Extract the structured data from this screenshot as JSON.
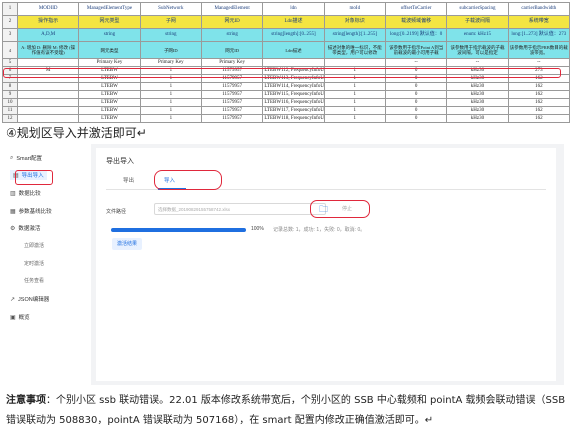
{
  "sheet": {
    "row_numbers": [
      "1",
      "2",
      "3",
      "4",
      "5",
      "6",
      "7",
      "8",
      "9",
      "10",
      "11",
      "12"
    ],
    "row1": [
      "MODIID",
      "ManagedElementType",
      "SubNetwork",
      "ManagedElement",
      "ldn",
      "moId",
      "offsetToCarrier",
      "subcarrierSpacing",
      "carrierBandwidth"
    ],
    "row2": [
      "操作指示",
      "网元类型",
      "子网",
      "网元ID",
      "Ldn描述",
      "对象标识",
      "载波频域偏移",
      "子载波间隔",
      "系统带宽"
    ],
    "row3": [
      "A,D,M",
      "string",
      "string",
      "string",
      "string[length]:[0..255]",
      "string[length]:[1..255]",
      "long:[0..2199]\n默认值：0",
      "enum:\nkHz15",
      "long:[1..273]\n默认值：273"
    ],
    "row4": [
      "A: 增加 D: 删除 M: 修改\n(操作值有误不受理)",
      "网元类型",
      "子网ID",
      "网元ID",
      "Ldn描述",
      "描述对象的唯一标识，不能带类型，用户可以修改",
      "该参数用于指示Point A到当前载波的最小可用子载",
      "该参数用于指示载波的子载波间隔，可以是指定",
      "该参数用于指示PRB数目的载波带宽。"
    ],
    "row5": [
      "",
      "",
      "",
      "",
      "",
      "Primary Key",
      "",
      "",
      "Primary Key",
      "Primary Key",
      "",
      "",
      "",
      ""
    ],
    "row5_cells": [
      "",
      "",
      "Primary Key",
      "Primary Key",
      "Primary Key",
      "",
      "Primary Key",
      "--",
      "--",
      "--"
    ],
    "data_rows": [
      {
        "rn": "6",
        "cells": [
          "M",
          "LTEBW",
          "1",
          "11579957",
          "LTEBW112, FrequencyInfoUL=1,",
          "1",
          "0",
          "kHz30",
          "273"
        ]
      },
      {
        "rn": "7",
        "cells": [
          "",
          "LTEBW",
          "1",
          "11579957",
          "LTEBW113, FrequencyInfoUL=1,",
          "1",
          "0",
          "kHz30",
          "162"
        ]
      },
      {
        "rn": "8",
        "cells": [
          "",
          "LTEBW",
          "1",
          "11579957",
          "LTEBW114, FrequencyInfoUL=1,",
          "1",
          "0",
          "kHz30",
          "162"
        ]
      },
      {
        "rn": "9",
        "cells": [
          "",
          "LTEBW",
          "1",
          "11579957",
          "LTEBW115, FrequencyInfoUL=1,",
          "1",
          "0",
          "kHz30",
          "162"
        ]
      },
      {
        "rn": "10",
        "cells": [
          "",
          "LTEBW",
          "1",
          "11579957",
          "LTEBW116, FrequencyInfoUL=1,",
          "1",
          "0",
          "kHz30",
          "162"
        ]
      },
      {
        "rn": "11",
        "cells": [
          "",
          "LTEBW",
          "1",
          "11579957",
          "LTEBW117, FrequencyInfoUL=1,",
          "1",
          "0",
          "kHz30",
          "162"
        ]
      },
      {
        "rn": "12",
        "cells": [
          "",
          "LTEBW",
          "1",
          "11579957",
          "LTEBW118, FrequencyInfoUL=1,",
          "1",
          "0",
          "kHz30",
          "162"
        ]
      }
    ]
  },
  "step_text": "④规划区导入并激活即可↵",
  "sidebar": {
    "items": [
      {
        "label": "Smart配置",
        "icon": "search-icon"
      },
      {
        "label": "导出导入",
        "icon": "document-icon"
      },
      {
        "label": "数据比较",
        "icon": "compare-icon"
      },
      {
        "label": "参数基线比较",
        "icon": "list-icon"
      },
      {
        "label": "数据激活",
        "icon": "gear-icon"
      },
      {
        "label": "立即激活",
        "icon": ""
      },
      {
        "label": "定时激活",
        "icon": ""
      },
      {
        "label": "任务查看",
        "icon": ""
      },
      {
        "label": "JSON编辑器",
        "icon": "code-icon"
      },
      {
        "label": "概览",
        "icon": "overview-icon"
      }
    ]
  },
  "main": {
    "title": "导出导入",
    "tabs": [
      "导出",
      "导入"
    ],
    "file_label": "文件路径",
    "file_path": "选择数据_20190829155758742.xlsx",
    "cancel": "停止",
    "percent": "100%",
    "log": "记录总数: 1，成功: 1，失败: 0，取消: 0。",
    "result_button": "激活结果"
  },
  "note": {
    "bold": "注意事项",
    "text": "：个别小区 ssb 联动错误。22.01 版本修改系统带宽后，个别小区的 SSB 中心载频和 pointA 载频会联动错误（SSB 错误联动为 508830，pointA 错误联动为 507168），在 smart 配置内修改正确值激活即可。↵"
  }
}
